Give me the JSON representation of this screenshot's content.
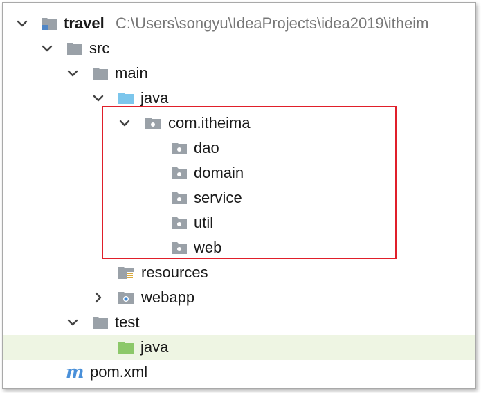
{
  "tree": {
    "root": {
      "label": "travel",
      "path": "C:\\Users\\songyu\\IdeaProjects\\idea2019\\itheim",
      "expanded": true,
      "icon": "module-folder-icon"
    },
    "src": {
      "label": "src",
      "expanded": true,
      "icon": "folder-icon"
    },
    "main": {
      "label": "main",
      "expanded": true,
      "icon": "folder-icon"
    },
    "main_java": {
      "label": "java",
      "expanded": true,
      "icon": "source-root-folder-icon"
    },
    "package": {
      "label": "com.itheima",
      "expanded": true,
      "icon": "package-icon"
    },
    "subpackages": [
      {
        "label": "dao",
        "icon": "package-icon"
      },
      {
        "label": "domain",
        "icon": "package-icon"
      },
      {
        "label": "service",
        "icon": "package-icon"
      },
      {
        "label": "util",
        "icon": "package-icon"
      },
      {
        "label": "web",
        "icon": "package-icon"
      }
    ],
    "resources": {
      "label": "resources",
      "icon": "resources-root-folder-icon"
    },
    "webapp": {
      "label": "webapp",
      "expanded": false,
      "icon": "web-folder-icon"
    },
    "test": {
      "label": "test",
      "expanded": true,
      "icon": "folder-icon"
    },
    "test_java": {
      "label": "java",
      "selected": true,
      "icon": "test-source-root-folder-icon"
    },
    "pom": {
      "label": "pom.xml",
      "icon": "maven-m-icon"
    }
  },
  "colors": {
    "highlight_border": "#e01f2a",
    "selection_bg": "#eef5e3",
    "folder_gray": "#9aa1a8",
    "source_blue": "#7cc6ec",
    "test_green": "#8cc869",
    "maven_blue": "#4a90d9"
  }
}
